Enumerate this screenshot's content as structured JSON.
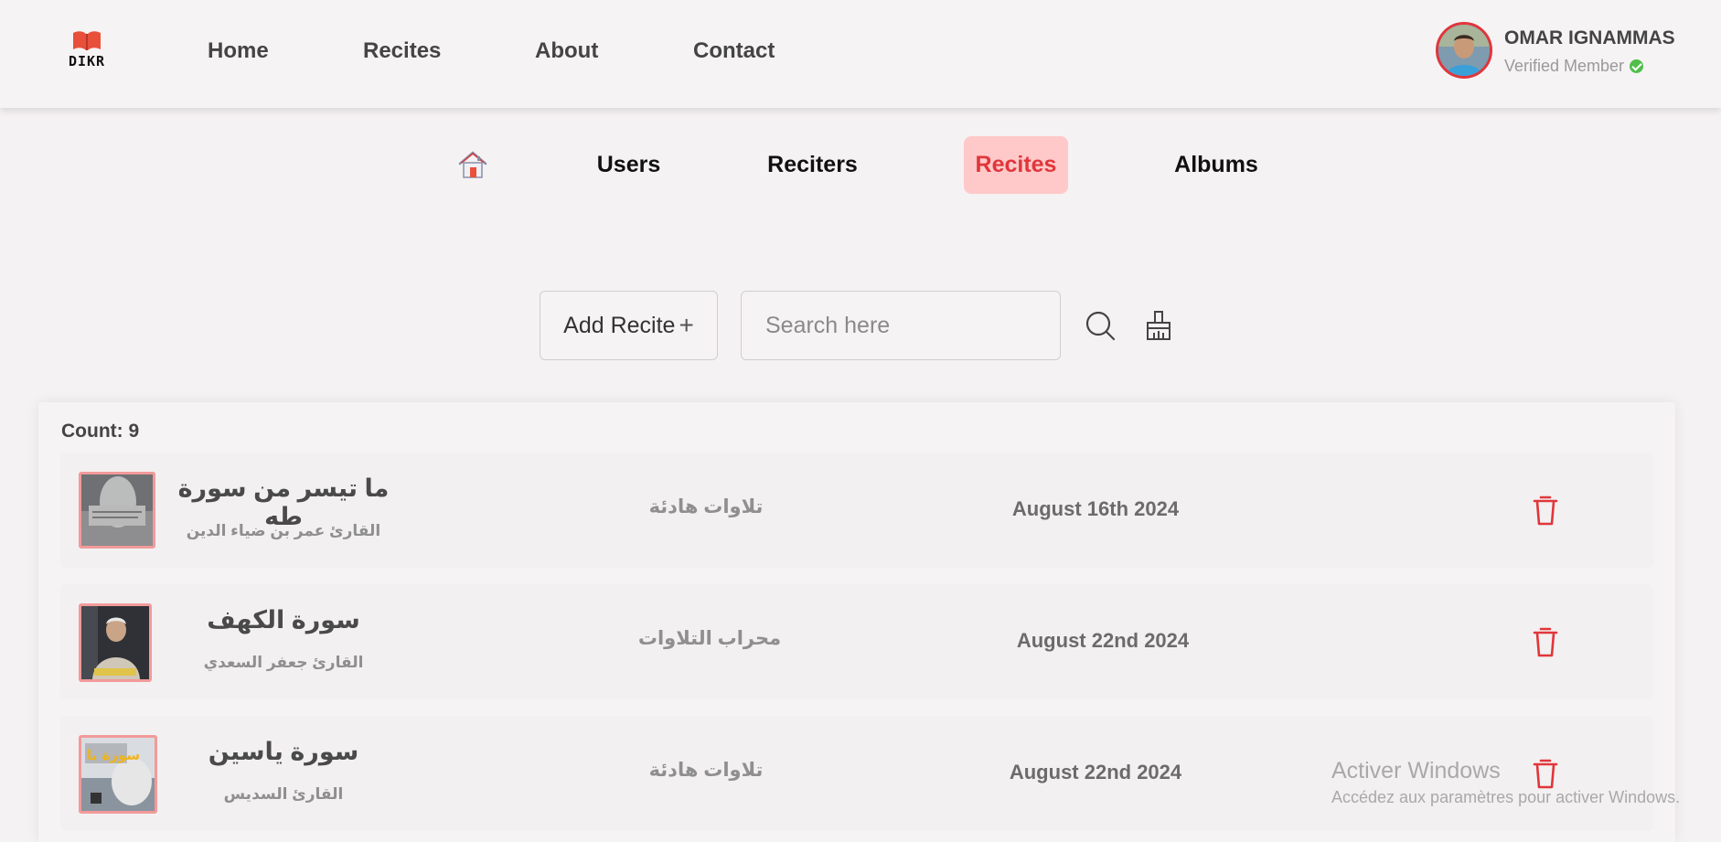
{
  "brand": {
    "logo_text": "DIKR",
    "logo_icon": "open-book-icon"
  },
  "nav": {
    "home": "Home",
    "recites": "Recites",
    "about": "About",
    "contact": "Contact"
  },
  "profile": {
    "name": "OMAR IGNAMMAS",
    "status": "Verified Member",
    "status_icon": "verified-check-icon"
  },
  "subnav": {
    "home_icon": "house-icon",
    "users": "Users",
    "reciters": "Reciters",
    "recites": "Recites",
    "albums": "Albums",
    "active": "recites"
  },
  "toolbar": {
    "add_label": "Add Recite",
    "add_symbol": "+",
    "search_placeholder": "Search here",
    "search_value": "",
    "search_icon": "magnifier-icon",
    "clear_icon": "broom-icon"
  },
  "list": {
    "count_label": "Count: 9",
    "rows": [
      {
        "title": "ما تيسر من سورة طه",
        "reciter": "القارئ عمر بن ضياء الدين",
        "album": "تلاوات هادئة",
        "date": "August 16th 2024",
        "delete_icon": "trash-icon"
      },
      {
        "title": "سورة الكهف",
        "reciter": "القارئ جعفر السعدي",
        "album": "محراب التلاوات",
        "date": "August 22nd 2024",
        "delete_icon": "trash-icon"
      },
      {
        "title": "سورة ياسين",
        "reciter": "القارئ السديس",
        "album": "تلاوات هادئة",
        "date": "August 22nd 2024",
        "delete_icon": "trash-icon"
      }
    ]
  },
  "watermark": {
    "title": "Activer Windows",
    "subtitle": "Accédez aux paramètres pour activer Windows."
  },
  "colors": {
    "accent": "#e0363b",
    "active_bg": "#ffc9c9",
    "page_bg": "#f5f2f3",
    "verified": "#4fbf4a"
  }
}
